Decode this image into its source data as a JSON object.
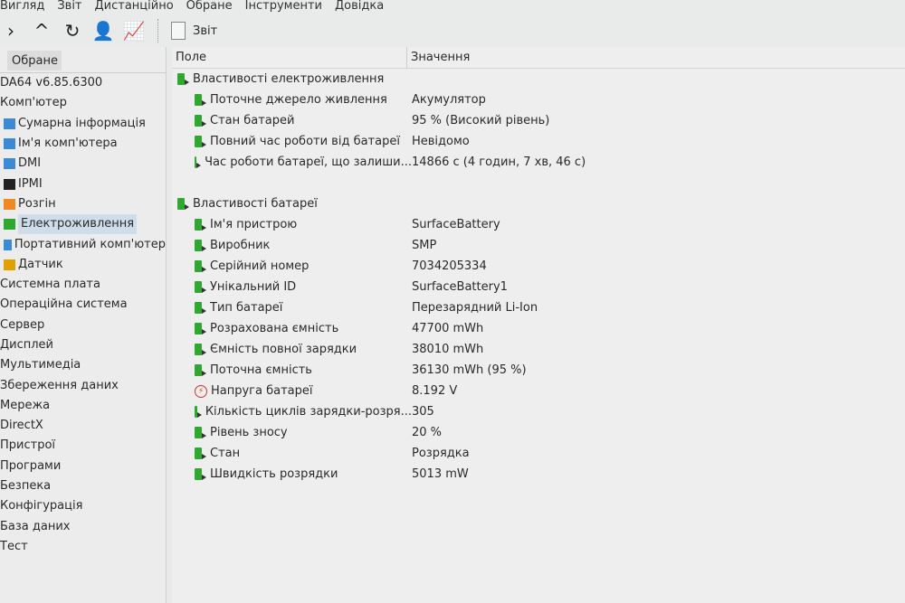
{
  "menu": [
    "Вигляд",
    "Звіт",
    "Дистанційно",
    "Обране",
    "Інструменти",
    "Довідка"
  ],
  "toolbar": {
    "report_label": "Звіт"
  },
  "left": {
    "tab": "Обране",
    "version": "DA64 v6.85.6300",
    "tree": [
      {
        "label": "Комп'ютер",
        "level": 0,
        "icon": "none"
      },
      {
        "label": "Сумарна інформація",
        "level": 1,
        "icon": "computer-icon"
      },
      {
        "label": "Ім'я комп'ютера",
        "level": 1,
        "icon": "computer-icon"
      },
      {
        "label": "DMI",
        "level": 1,
        "icon": "computer-icon"
      },
      {
        "label": "IPMI",
        "level": 1,
        "icon": "server-icon"
      },
      {
        "label": "Розгін",
        "level": 1,
        "icon": "flame-icon"
      },
      {
        "label": "Електроживлення",
        "level": 1,
        "icon": "battery-icon",
        "selected": true
      },
      {
        "label": "Портативний комп'ютер",
        "level": 1,
        "icon": "laptop-icon"
      },
      {
        "label": "Датчик",
        "level": 1,
        "icon": "gauge-icon"
      },
      {
        "label": "Системна плата",
        "level": 0
      },
      {
        "label": "Операційна система",
        "level": 0
      },
      {
        "label": "Сервер",
        "level": 0
      },
      {
        "label": "Дисплей",
        "level": 0
      },
      {
        "label": "Мультимедіа",
        "level": 0
      },
      {
        "label": "Збереження даних",
        "level": 0
      },
      {
        "label": "Мережа",
        "level": 0
      },
      {
        "label": "DirectX",
        "level": 0
      },
      {
        "label": "Пристрої",
        "level": 0
      },
      {
        "label": "Програми",
        "level": 0
      },
      {
        "label": "Безпека",
        "level": 0
      },
      {
        "label": "Конфігурація",
        "level": 0
      },
      {
        "label": "База даних",
        "level": 0
      },
      {
        "label": "Тест",
        "level": 0
      }
    ]
  },
  "table": {
    "col_field": "Поле",
    "col_value": "Значення",
    "groups": [
      {
        "title": "Властивості електроживлення",
        "rows": [
          [
            "Поточне джерело живлення",
            "Акумулятор"
          ],
          [
            "Стан батарей",
            "95 % (Високий рівень)"
          ],
          [
            "Повний час роботи від батареї",
            "Невідомо"
          ],
          [
            "Час роботи батареї, що залиши...",
            "14866 с (4 годин, 7 хв, 46 с)"
          ]
        ]
      },
      {
        "title": "Властивості батареї",
        "rows": [
          [
            "Ім'я пристрою",
            "SurfaceBattery"
          ],
          [
            "Виробник",
            "SMP"
          ],
          [
            "Серійний номер",
            "7034205334"
          ],
          [
            "Унікальний ID",
            "SurfaceBattery1"
          ],
          [
            "Тип батареї",
            "Перезарядний Li-Ion"
          ],
          [
            "Розрахована ємність",
            "47700 mWh"
          ],
          [
            "Ємність повної зарядки",
            "38010 mWh"
          ],
          [
            "Поточна ємність",
            "36130 mWh  (95 %)"
          ],
          [
            "Напруга батареї",
            "8.192 V"
          ],
          [
            "Кількість циклів зарядки-розря...",
            "305"
          ],
          [
            "Рівень зносу",
            "20 %"
          ],
          [
            "Стан",
            "Розрядка"
          ],
          [
            "Швидкість розрядки",
            "5013 mW"
          ]
        ]
      }
    ]
  }
}
